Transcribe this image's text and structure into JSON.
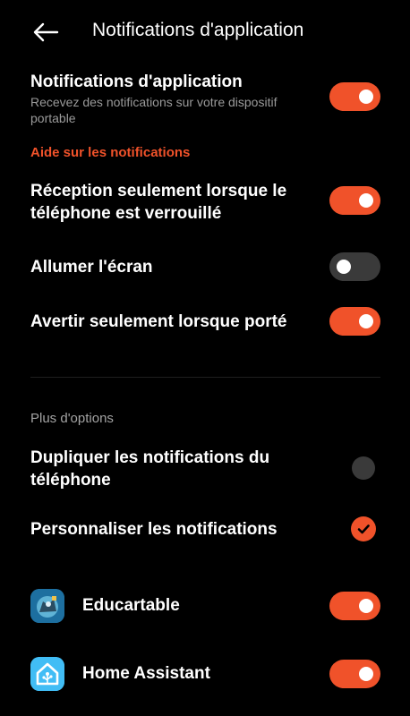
{
  "header": {
    "title": "Notifications d'application",
    "back_icon": "arrow-left-icon"
  },
  "settings": {
    "app_notifications": {
      "label": "Notifications d'application",
      "description": "Recevez des notifications sur votre dispositif portable",
      "enabled": true
    },
    "help_link": "Aide sur les notifications",
    "locked_only": {
      "label_line1": "Réception seulement lorsque le",
      "label_line2": "téléphone est verrouillé",
      "enabled": true
    },
    "wake_screen": {
      "label": "Allumer l'écran",
      "enabled": false
    },
    "worn_only": {
      "label": "Avertir seulement lorsque porté",
      "enabled": true
    }
  },
  "more_options": {
    "section_title": "Plus d'options",
    "duplicate": {
      "label_line1": "Dupliquer les notifications du",
      "label_line2": "téléphone",
      "selected": false
    },
    "customize": {
      "label": "Personnaliser les notifications",
      "selected": true
    }
  },
  "apps": [
    {
      "name": "Educartable",
      "icon": "educartable-app-icon",
      "enabled": true
    },
    {
      "name": "Home Assistant",
      "icon": "home-assistant-app-icon",
      "enabled": true
    }
  ],
  "colors": {
    "accent": "#f0522a",
    "off": "#3a3a3a",
    "background": "#000000",
    "secondary_text": "#9a9a9a"
  }
}
